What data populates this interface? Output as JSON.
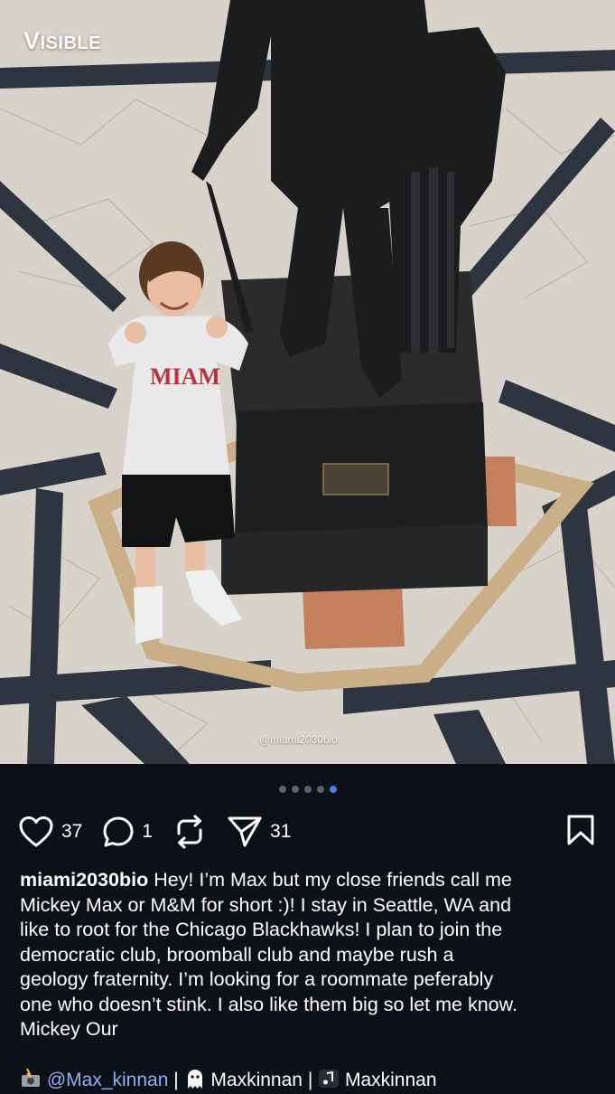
{
  "photo": {
    "watermark_logo": "VISIBLE",
    "credit": "@miami2030bio",
    "subject_shirt_text": "MIAM"
  },
  "carousel": {
    "total": 5,
    "active_index": 4
  },
  "actions": {
    "likes": "37",
    "comments": "1",
    "shares": "31",
    "icons": [
      "heart-icon",
      "comment-icon",
      "repost-icon",
      "send-icon",
      "bookmark-icon"
    ]
  },
  "caption": {
    "username": "miami2030bio",
    "lines": [
      " Hey! I’m Max but my close friends call me",
      "Mickey Max or M&M for short :)! I stay in Seattle, WA and",
      "like to root for the Chicago Blackhawks! I plan to join the",
      "democratic club, broomball club and maybe rush a",
      "geology fraternity. I’m looking for a roommate peferably",
      "one who doesn’t stink. I also like them big so let me know.",
      "Mickey Our"
    ]
  },
  "links_row": {
    "mention": "@Max_kinnan",
    "separator": "|",
    "snapchat": "Maxkinnan",
    "tiktok": "Maxkinnan"
  },
  "colors": {
    "background": "#0d1016",
    "dot_active": "#4b7cf1",
    "dot_inactive": "#5d616a",
    "mention": "#8fb0f5"
  }
}
